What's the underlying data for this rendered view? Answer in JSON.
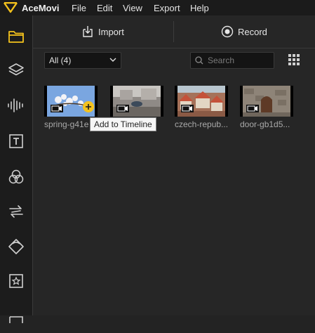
{
  "app": {
    "name": "AceMovi"
  },
  "menu": [
    "File",
    "Edit",
    "View",
    "Export",
    "Help"
  ],
  "colors": {
    "accent": "#f4c21d",
    "background": "#262626",
    "rail": "#1c1c1c"
  },
  "rail": [
    {
      "icon": "folder-icon",
      "active": true
    },
    {
      "icon": "layers-icon",
      "active": false
    },
    {
      "icon": "audio-wave-icon",
      "active": false
    },
    {
      "icon": "text-icon",
      "active": false
    },
    {
      "icon": "filters-icon",
      "active": false
    },
    {
      "icon": "transitions-icon",
      "active": false
    },
    {
      "icon": "overlay-icon",
      "active": false
    },
    {
      "icon": "elements-icon",
      "active": false
    }
  ],
  "toolbar": {
    "import_label": "Import",
    "record_label": "Record"
  },
  "filter": {
    "selected": "All (4)"
  },
  "search": {
    "placeholder": "Search"
  },
  "media": [
    {
      "label": "spring-g41e",
      "icon": "video-icon"
    },
    {
      "label": "",
      "icon": "video-icon"
    },
    {
      "label": "czech-repub...",
      "icon": "video-icon"
    },
    {
      "label": "door-gb1d5...",
      "icon": "video-icon"
    }
  ],
  "tooltip": "Add to Timeline"
}
